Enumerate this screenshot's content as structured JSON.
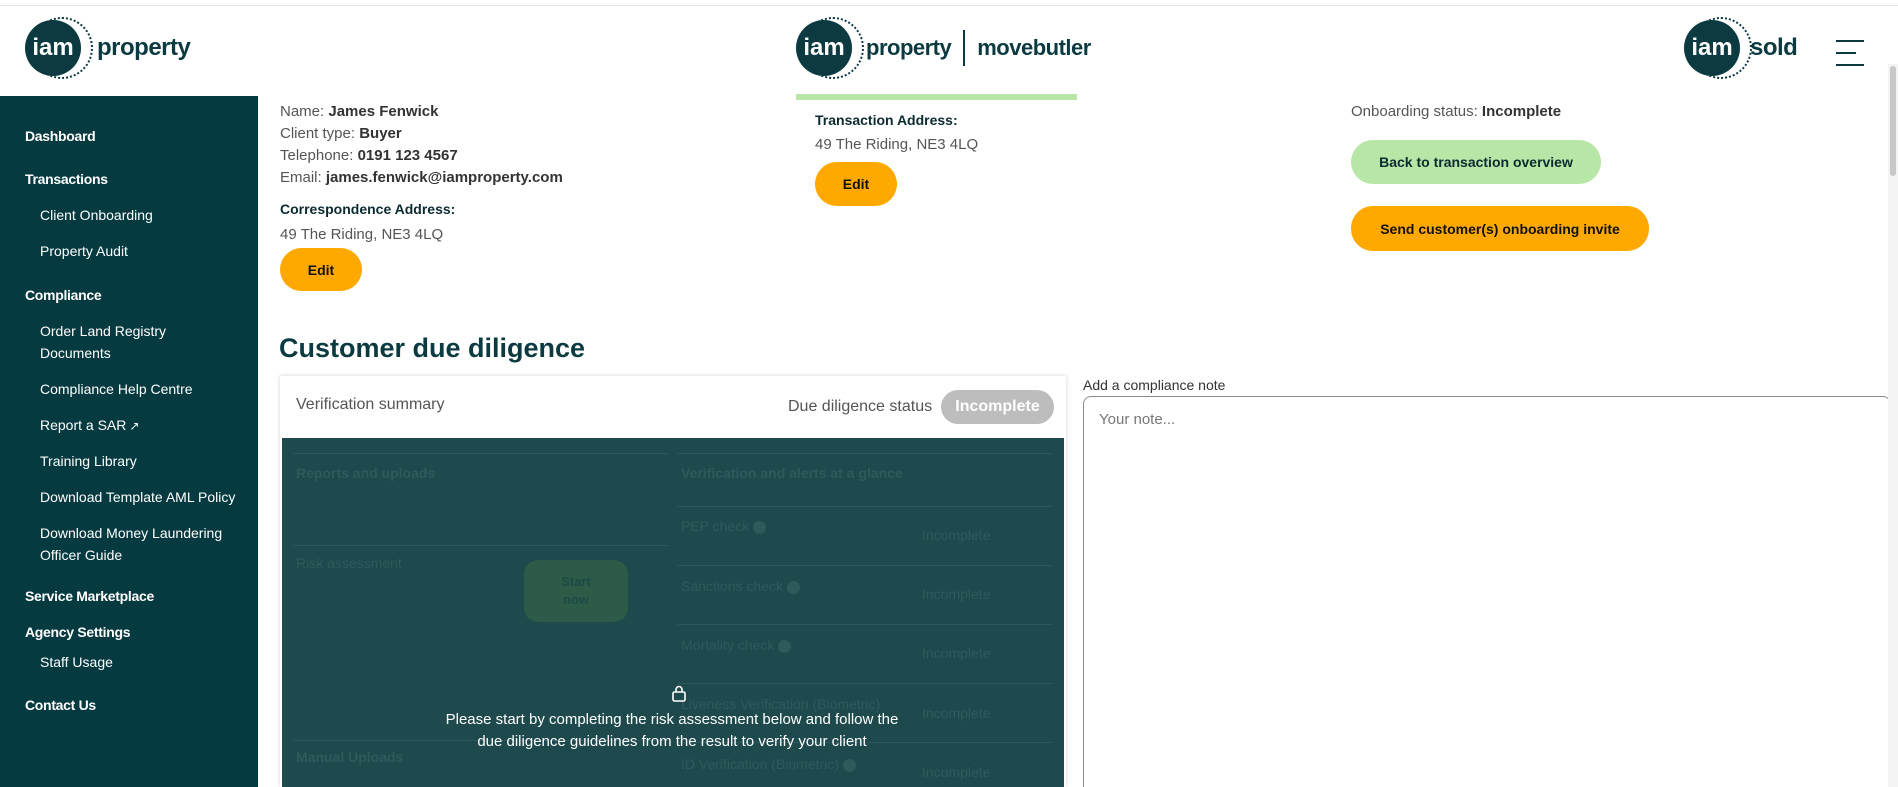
{
  "header": {
    "logo_left": {
      "circle": "iam",
      "word": "property"
    },
    "logo_center": {
      "circle": "iam",
      "word": "property",
      "partner": "movebutler"
    },
    "logo_right": {
      "circle": "iam",
      "word": "sold"
    },
    "menu_icon": "hamburger-icon"
  },
  "sidebar": {
    "dashboard": "Dashboard",
    "transactions": "Transactions",
    "client_onboarding": "Client Onboarding",
    "property_audit": "Property Audit",
    "compliance": "Compliance",
    "order_land_registry": "Order Land Registry Documents",
    "compliance_help": "Compliance Help Centre",
    "report_sar": "Report a SAR",
    "training_library": "Training Library",
    "download_aml": "Download Template AML Policy",
    "download_mlo": "Download Money Laundering Officer Guide",
    "service_marketplace": "Service Marketplace",
    "agency_settings": "Agency Settings",
    "staff_usage": "Staff Usage",
    "contact_us": "Contact Us"
  },
  "client": {
    "name_label": "Name:",
    "name": "James Fenwick",
    "type_label": "Client type:",
    "type": "Buyer",
    "phone_label": "Telephone:",
    "phone": "0191 123 4567",
    "email_label": "Email:",
    "email": "james.fenwick@iamproperty.com",
    "corr_label": "Correspondence Address:",
    "corr_address": "49 The Riding, NE3 4LQ",
    "edit_label": "Edit"
  },
  "transaction": {
    "label": "Transaction Address:",
    "address": "49 The Riding, NE3 4LQ",
    "edit_label": "Edit"
  },
  "onboarding": {
    "status_label": "Onboarding status:",
    "status": "Incomplete",
    "back_button": "Back to transaction overview",
    "invite_button": "Send customer(s) onboarding invite"
  },
  "cdd": {
    "title": "Customer due diligence",
    "summary_title": "Verification summary",
    "status_label": "Due diligence status",
    "status": "Incomplete",
    "reports_heading": "Reports and uploads",
    "risk_assessment": "Risk assessment",
    "start_now": "Start now",
    "manual_uploads": "Manual Uploads",
    "alerts_heading": "Verification and alerts at a glance",
    "checks": [
      {
        "name": "PEP check",
        "status": "Incomplete"
      },
      {
        "name": "Sanctions check",
        "status": "Incomplete"
      },
      {
        "name": "Mortality check",
        "status": "Incomplete"
      },
      {
        "name": "Liveness Verification (Biometric)",
        "status": "Incomplete"
      },
      {
        "name": "ID Verification (Biometric)",
        "status": "Incomplete"
      }
    ],
    "locked_message": "Please start by completing the risk assessment below and follow the due diligence guidelines from the result to verify your client"
  },
  "note": {
    "label": "Add a compliance note",
    "placeholder": "Your note..."
  },
  "colors": {
    "sidebar_bg": "#063a41",
    "accent_yellow": "#ffa800",
    "accent_green": "#b8e6a6",
    "overlay": "#1e4a4e"
  }
}
